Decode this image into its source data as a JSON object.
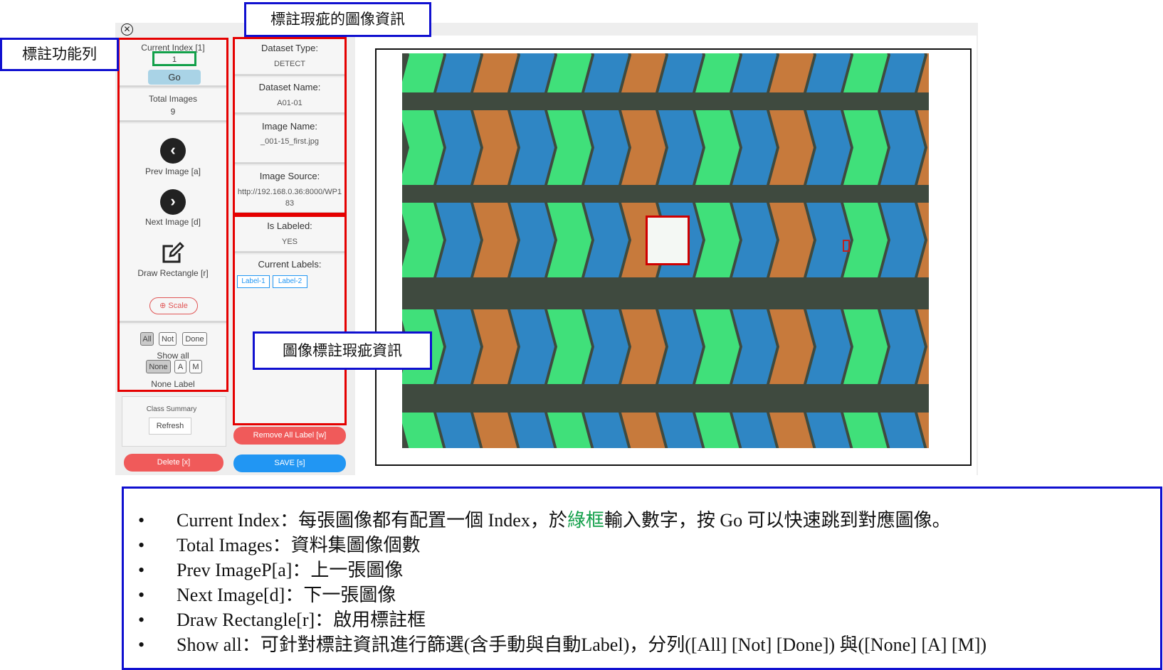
{
  "close_icon": "circle-x-icon",
  "callouts": {
    "toolbar": "標註功能列",
    "image_info": "標註瑕疵的圖像資訊",
    "defect_info": "圖像標註瑕疵資訊"
  },
  "sidebar": {
    "current_index_label": "Current Index [1]",
    "current_index_value": "1",
    "go_label": "Go",
    "total_images_label": "Total Images",
    "total_images_value": "9",
    "prev_label": "Prev Image [a]",
    "next_label": "Next Image [d]",
    "draw_label": "Draw Rectangle [r]",
    "scale_label": "Scale",
    "filters_row1": [
      "All",
      "Not",
      "Done"
    ],
    "show_all_label": "Show all",
    "filters_row2": [
      "None",
      "A",
      "M"
    ],
    "none_label": "None Label",
    "class_summary_label": "Class Summary",
    "refresh_label": "Refresh",
    "delete_label": "Delete [x]"
  },
  "info": {
    "dataset_type_label": "Dataset Type:",
    "dataset_type_value": "DETECT",
    "dataset_name_label": "Dataset Name:",
    "dataset_name_value": "A01-01",
    "image_name_label": "Image Name:",
    "image_name_value": "_001-15_first.jpg",
    "image_source_label": "Image Source:",
    "image_source_value_1": "http://192.168.0.36:8000/WP1",
    "image_source_value_2": "83",
    "is_labeled_label": "Is Labeled:",
    "is_labeled_value": "YES",
    "current_labels_label": "Current Labels:",
    "labels": [
      "Label-1",
      "Label-2"
    ],
    "remove_all_label": "Remove All Label [w]",
    "save_label": "SAVE [s]"
  },
  "colors": {
    "green": "#40e07a",
    "blue": "#2f86c4",
    "orange": "#c77a3c",
    "dark": "#3f4a3f"
  },
  "notes": {
    "n1_a": "Current Index：每張圖像都有配置一個 Index，於",
    "n1_green": "綠框",
    "n1_b": "輸入數字，按  Go 可以快速跳到對應圖像。",
    "n2": "Total Images：資料集圖像個數",
    "n3": "Prev ImageP[a]：上一張圖像",
    "n4": "Next Image[d]：下一張圖像",
    "n5": "Draw Rectangle[r]：啟用標註框",
    "n6": "Show all：可針對標註資訊進行篩選(含手動與自動Label)，分列([All] [Not] [Done]) 與([None] [A] [M])",
    "bullet": "•"
  }
}
